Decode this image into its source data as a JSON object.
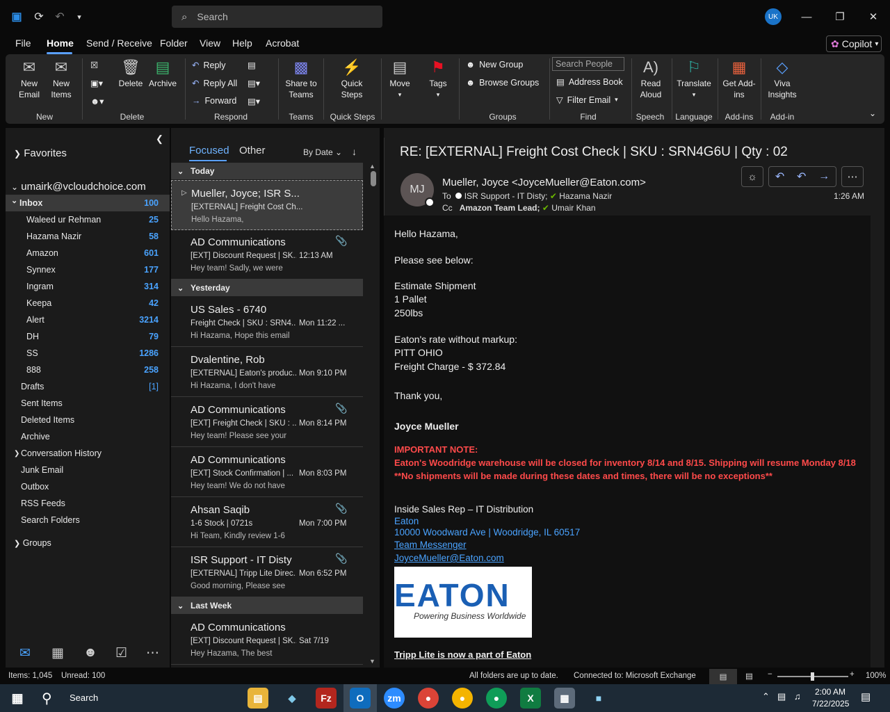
{
  "titlebar": {
    "search_placeholder": "Search",
    "user_initials": "UK"
  },
  "menu": {
    "items": [
      "File",
      "Home",
      "Send / Receive",
      "Folder",
      "View",
      "Help",
      "Acrobat"
    ],
    "copilot": "Copilot"
  },
  "ribbon": {
    "new_email": "New Email",
    "new_items": "New Items",
    "group_new": "New",
    "delete": "Delete",
    "archive": "Archive",
    "group_delete": "Delete",
    "reply": "Reply",
    "reply_all": "Reply All",
    "forward": "Forward",
    "group_respond": "Respond",
    "share_teams": "Share to Teams",
    "group_teams": "Teams",
    "quick_steps": "Quick Steps",
    "group_quick": "Quick Steps",
    "move": "Move",
    "tags": "Tags",
    "new_group": "New Group",
    "browse_groups": "Browse Groups",
    "group_groups": "Groups",
    "search_people": "Search People",
    "address_book": "Address Book",
    "filter_email": "Filter Email",
    "group_find": "Find",
    "read_aloud": "Read Aloud",
    "group_speech": "Speech",
    "translate": "Translate",
    "group_language": "Language",
    "get_addins": "Get Add-ins",
    "group_addins": "Add-ins",
    "viva": "Viva Insights",
    "group_addin": "Add-in"
  },
  "folders": {
    "favorites": "Favorites",
    "account": "umairk@vcloudchoice.com",
    "items": [
      {
        "name": "Inbox",
        "count": "100"
      },
      {
        "name": "Waleed ur Rehman",
        "count": "25"
      },
      {
        "name": "Hazama Nazir",
        "count": "58"
      },
      {
        "name": "Amazon",
        "count": "601"
      },
      {
        "name": "Synnex",
        "count": "177"
      },
      {
        "name": "Ingram",
        "count": "314"
      },
      {
        "name": "Keepa",
        "count": "42"
      },
      {
        "name": "Alert",
        "count": "3214"
      },
      {
        "name": "DH",
        "count": "79"
      },
      {
        "name": "SS",
        "count": "1286"
      },
      {
        "name": "888",
        "count": "258"
      },
      {
        "name": "Drafts",
        "count": "[1]"
      },
      {
        "name": "Sent Items",
        "count": ""
      },
      {
        "name": "Deleted Items",
        "count": ""
      },
      {
        "name": "Archive",
        "count": ""
      },
      {
        "name": "Conversation History",
        "count": ""
      },
      {
        "name": "Junk Email",
        "count": ""
      },
      {
        "name": "Outbox",
        "count": ""
      },
      {
        "name": "RSS Feeds",
        "count": ""
      },
      {
        "name": "Search Folders",
        "count": ""
      }
    ],
    "groups": "Groups"
  },
  "list": {
    "tab_focused": "Focused",
    "tab_other": "Other",
    "sort": "By Date",
    "group_today": "Today",
    "group_yesterday": "Yesterday",
    "group_lastweek": "Last Week",
    "messages": [
      {
        "from": "Mueller, Joyce;  ISR S...",
        "subj": "[EXTERNAL] Freight Cost Ch...",
        "time": "",
        "prev": "Hello Hazama,"
      },
      {
        "from": "AD Communications",
        "subj": "[EXT] Discount Request | SK...",
        "time": "12:13 AM",
        "prev": "Hey team!  Sadly, we were"
      },
      {
        "from": "US Sales - 6740",
        "subj": "Freight Check | SKU : SRN4...",
        "time": "Mon 11:22 ...",
        "prev": "Hi Hazama,    Hope this email"
      },
      {
        "from": "Dvalentine, Rob",
        "subj": "[EXTERNAL] Eaton's produc...",
        "time": "Mon 9:10 PM",
        "prev": "Hi Hazama,   I don't have"
      },
      {
        "from": "AD Communications",
        "subj": "[EXT] Freight Check | SKU : ...",
        "time": "Mon 8:14 PM",
        "prev": "Hey team!  Please see your"
      },
      {
        "from": "AD Communications",
        "subj": "[EXT] Stock Confirmation | ...",
        "time": "Mon 8:03 PM",
        "prev": "Hey team!  We do not have"
      },
      {
        "from": "Ahsan Saqib",
        "subj": "1-6 Stock | 0721s",
        "time": "Mon 7:00 PM",
        "prev": "Hi Team,  Kindly review 1-6"
      },
      {
        "from": "ISR Support - IT Disty",
        "subj": "[EXTERNAL] Tripp Lite Direc...",
        "time": "Mon 6:52 PM",
        "prev": "Good morning,   Please see"
      },
      {
        "from": "AD Communications",
        "subj": "[EXT] Discount Request | SK...",
        "time": "Sat 7/19",
        "prev": "Hey Hazama,   The best"
      }
    ]
  },
  "reading": {
    "subject": "RE: [EXTERNAL] Freight Cost Check | SKU : SRN4G6U | Qty : 02",
    "sender_initials": "MJ",
    "sender": "Mueller, Joyce <JoyceMueller@Eaton.com>",
    "to_label": "To",
    "to1": "ISR Support - IT Disty;",
    "to2": "Hazama Nazir",
    "cc_label": "Cc",
    "cc1": "Amazon Team Lead;",
    "cc2": "Umair Khan",
    "time": "1:26 AM",
    "body": {
      "greet": "Hello Hazama,",
      "see": "Please see below:",
      "est": "Estimate Shipment",
      "pallet": "1 Pallet",
      "lbs": "250lbs",
      "rate": "Eaton's rate without markup:",
      "carrier": "PITT OHIO",
      "charge": "Freight Charge - $ 372.84",
      "thanks": "Thank you,",
      "name": "Joyce Mueller",
      "imp": "IMPORTANT NOTE:",
      "imp1": "Eaton's Woodridge warehouse will be closed for inventory 8/14 and 8/15. Shipping will resume Monday 8/18",
      "imp2": "**No shipments will be made during these dates and times, there will be no exceptions**",
      "role": "Inside Sales Rep – IT Distribution",
      "company": "Eaton",
      "address": "10000 Woodward Ave | Woodridge, IL 60517",
      "messenger": "Team Messenger",
      "email": "JoyceMueller@Eaton.com",
      "logo_text": "EATON",
      "logo_tag": "Powering Business Worldwide",
      "tripp": "Tripp Lite is now a part of Eaton"
    }
  },
  "status": {
    "items": "Items: 1,045",
    "unread": "Unread: 100",
    "sync": "All folders are up to date.",
    "conn": "Connected to: Microsoft Exchange",
    "zoom": "100%"
  },
  "taskbar": {
    "search": "Search",
    "time": "2:00 AM",
    "date": "7/22/2025"
  }
}
